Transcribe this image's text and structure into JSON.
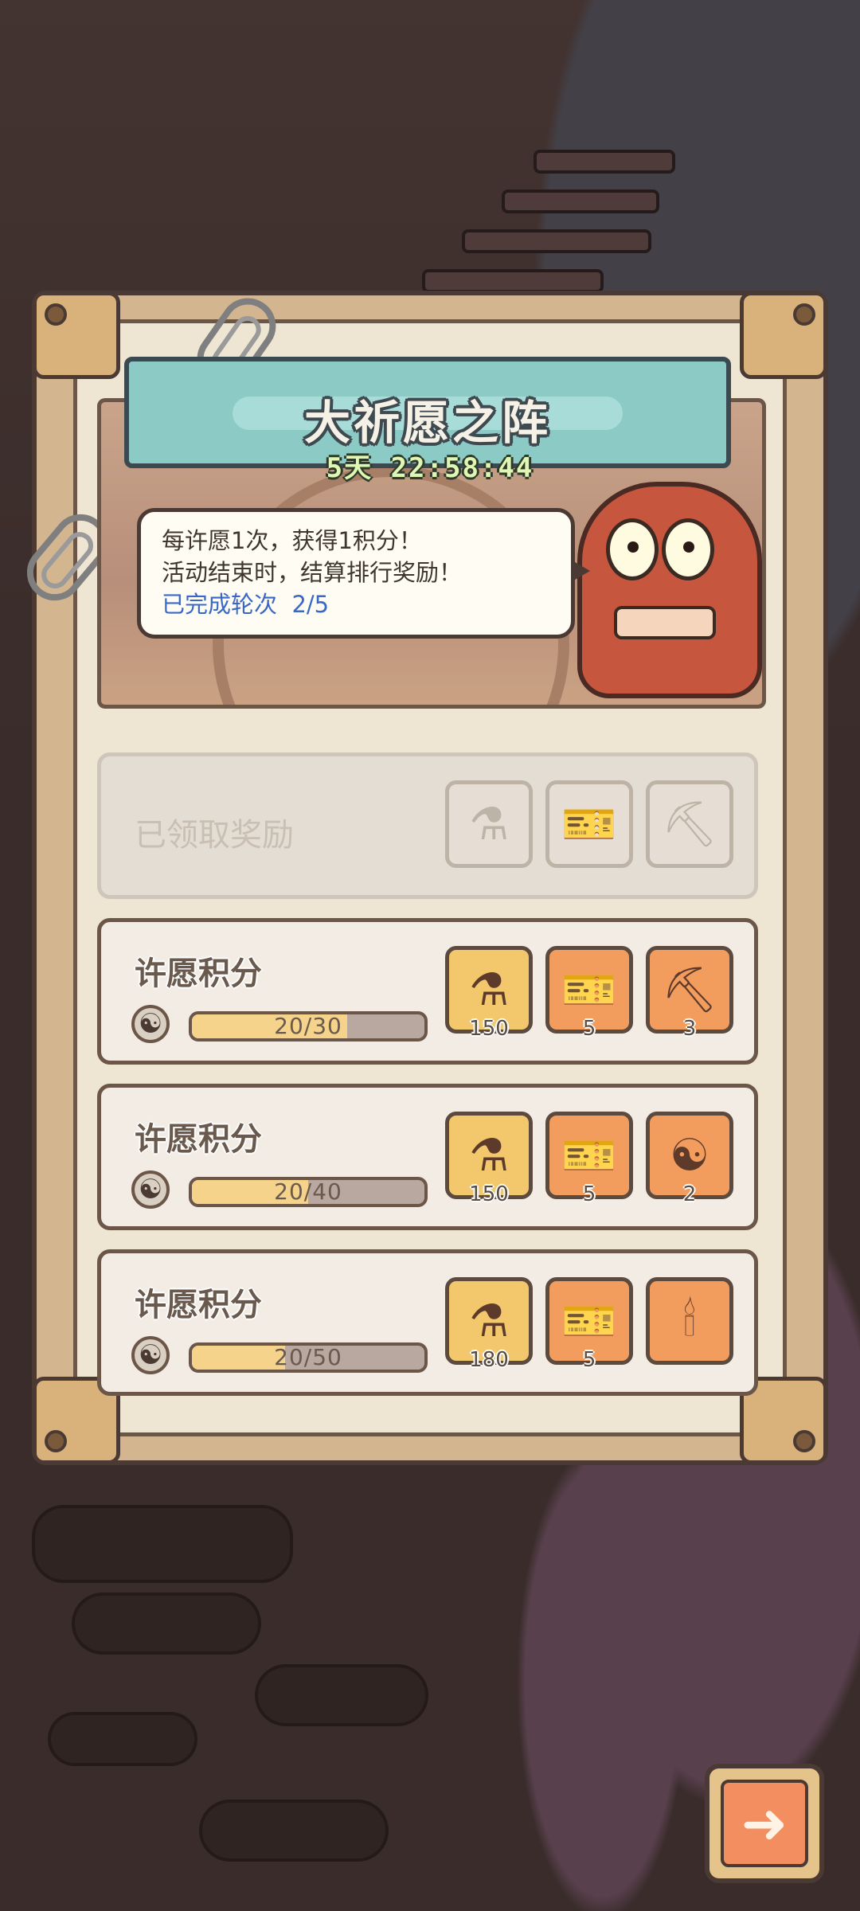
{
  "event": {
    "title": "大祈愿之阵",
    "countdown": "5天 22:58:44",
    "info_line1": "每许愿1次，获得1积分！",
    "info_line2": "活动结束时，结算排行奖励！",
    "rounds_label": "已完成轮次",
    "rounds_value": "2/5"
  },
  "claimed_row": {
    "label": "已领取奖励",
    "items": [
      {
        "icon": "potion-icon"
      },
      {
        "icon": "ticket-icon"
      },
      {
        "icon": "pickaxe-icon"
      }
    ]
  },
  "tiers": [
    {
      "label": "许愿积分",
      "progress_text": "20/30",
      "progress": 0.667,
      "items": [
        {
          "icon": "potion-icon",
          "qty": "150"
        },
        {
          "icon": "ticket-icon",
          "qty": "5"
        },
        {
          "icon": "pickaxe-icon",
          "qty": "3"
        }
      ]
    },
    {
      "label": "许愿积分",
      "progress_text": "20/40",
      "progress": 0.5,
      "items": [
        {
          "icon": "potion-icon",
          "qty": "150"
        },
        {
          "icon": "ticket-icon",
          "qty": "5"
        },
        {
          "icon": "yinyang-coin-icon",
          "qty": "2"
        }
      ]
    },
    {
      "label": "许愿积分",
      "progress_text": "20/50",
      "progress": 0.4,
      "items": [
        {
          "icon": "potion-icon",
          "qty": "180"
        },
        {
          "icon": "ticket-icon",
          "qty": "5"
        },
        {
          "icon": "torch-icon",
          "qty": ""
        }
      ]
    }
  ],
  "colors": {
    "panel": "#d3b590",
    "title_plate": "#8ccac6",
    "reward_orange": "#f29c5e",
    "reward_gold": "#f3c86c",
    "progress_fill": "#f5d38a",
    "link_blue": "#3a68c8"
  }
}
